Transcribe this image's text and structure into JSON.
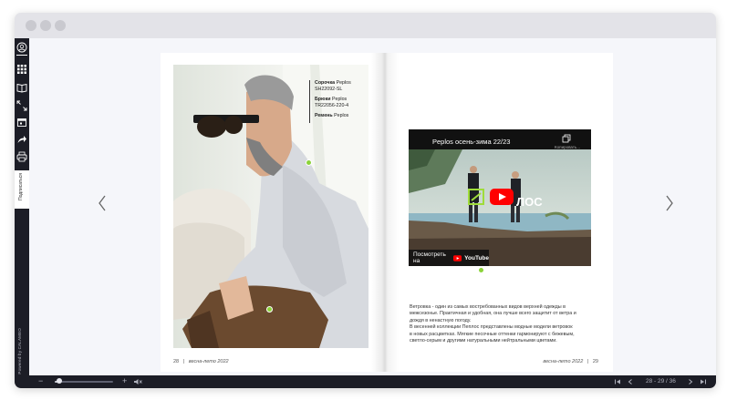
{
  "sidebar": {
    "icons": [
      "user-circle-icon",
      "grid-icon",
      "book-icon",
      "fullscreen-icon",
      "calendar-icon",
      "share-icon",
      "print-icon"
    ],
    "subscribe_label": "Подписаться",
    "powered_label": "Powered by CALAMEO"
  },
  "left_page": {
    "specs": [
      {
        "name": "Сорочка",
        "brand": "Peplos",
        "code": "SH22092-SL"
      },
      {
        "name": "Брюки",
        "brand": "Peplos",
        "code": "TR22056-220-4"
      },
      {
        "name": "Ремень",
        "brand": "Peplos",
        "code": ""
      }
    ],
    "page_number": "28",
    "season": "весна-лето 2022"
  },
  "right_page": {
    "video": {
      "title": "Peplos осень-зима 22/23",
      "copy_label": "Копировать...",
      "watch_label": "Посмотреть на",
      "youtube_label": "YouTube",
      "logo_text": "ЛОС"
    },
    "description": [
      "Ветровка - один из самых востребованных видов верхней одежды в",
      "межсезонье. Практичная и удобная, она лучше всего защитит от ветра и",
      "дождя в ненастную погоду.",
      "В весенней коллекции Пеплос представлены модные модели ветровок",
      "в новых расцветках. Мягкие песочные оттенки гармонируют с бежевым,",
      "светло-серым и другими натуральными нейтральными цветами."
    ],
    "page_number": "29",
    "season": "весна-лето 2022"
  },
  "bottombar": {
    "zoom_out": "−",
    "zoom_in": "+",
    "page_indicator": "28 - 29 / 36",
    "zoom_level": 0.08
  },
  "colors": {
    "sidebar_bg": "#1c1d26",
    "hotspot": "#8bd33a",
    "youtube_red": "#ff0000"
  }
}
